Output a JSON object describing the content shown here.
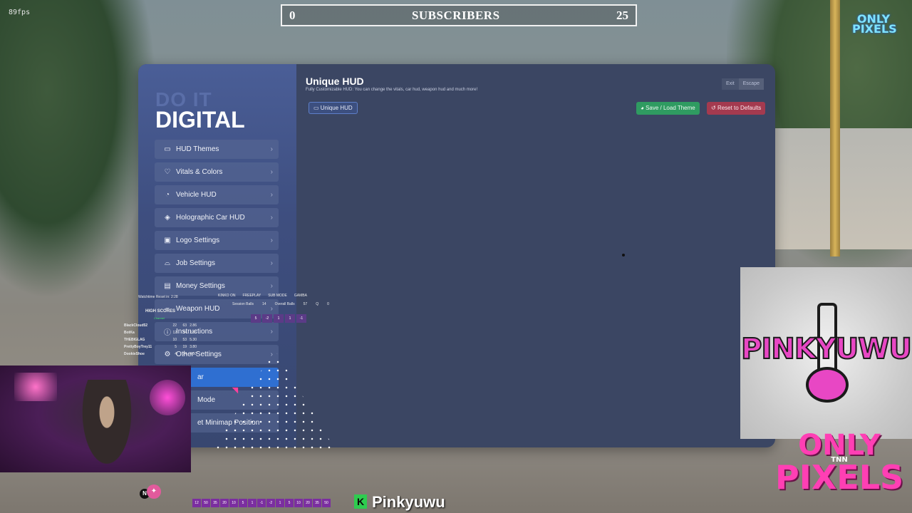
{
  "overlay_top": {
    "fps": "89fps",
    "subscribers_left": "0",
    "subscribers_label": "SUBSCRIBERS",
    "subscribers_right": "25",
    "corner_logo": "ONLY PIXELS"
  },
  "panel": {
    "brand_top": "DO IT",
    "brand_bottom": "DIGITAL",
    "title": "Unique HUD",
    "subtitle": "Fully Customizable HUD: You can change the vitals, car hud, weapon hud and much more!",
    "exit_label": "Exit",
    "escape_label": "Escape",
    "tab_label": "Unique HUD",
    "save_label": "Save / Load Theme",
    "reset_label": "Reset to Defaults",
    "menu": [
      {
        "label": "HUD Themes",
        "icon": "monitor-icon"
      },
      {
        "label": "Vitals & Colors",
        "icon": "heart-icon"
      },
      {
        "label": "Vehicle HUD",
        "icon": "speedometer-icon"
      },
      {
        "label": "Holographic Car HUD",
        "icon": "cube-icon"
      },
      {
        "label": "Logo Settings",
        "icon": "image-icon"
      },
      {
        "label": "Job Settings",
        "icon": "helmet-icon"
      },
      {
        "label": "Money Settings",
        "icon": "money-icon"
      },
      {
        "label": "Weapon HUD",
        "icon": "gun-icon"
      },
      {
        "label": "Instructions",
        "icon": "info-icon"
      },
      {
        "label": "Other Settings",
        "icon": "gear-icon"
      },
      {
        "label": "ar",
        "icon": ""
      },
      {
        "label": "Mode",
        "icon": ""
      },
      {
        "label": "et Minimap Position",
        "icon": ""
      }
    ]
  },
  "stats_overlay": {
    "watch": "Watchtime Reset in: 2:28",
    "kinko": "KINKO ON",
    "freeplay": "FREEPLAY",
    "submode": "SUB MODE",
    "gamba": "GAMBA",
    "session_balls_label": "Session Balls",
    "session_balls": "14",
    "overall_balls_label": "Overall Balls",
    "overall_balls": "57",
    "q": "Q",
    "zero": "0",
    "high_scores": "HIGH SCORES",
    "channel": "Channel",
    "nums": [
      "5",
      "-2",
      "1",
      "1",
      "-1"
    ],
    "rows": [
      {
        "name": "BlackCloud52",
        "a": "22",
        "b": "63",
        "c": "2.86"
      },
      {
        "name": "BotKa",
        "a": "12",
        "b": "34",
        "c": "2.83"
      },
      {
        "name": "THEBIGLAG",
        "a": "10",
        "b": "53",
        "c": "5.30"
      },
      {
        "name": "PrettyBoyTrey11",
        "a": "5",
        "b": "19",
        "c": "3.80"
      },
      {
        "name": "DookieShoe",
        "a": "4",
        "b": "14",
        "c": "3.50"
      }
    ]
  },
  "bottom": {
    "strip": [
      "12",
      "50",
      "35",
      "20",
      "10",
      "5",
      "1",
      "-1",
      "-2",
      "1",
      "5",
      "10",
      "20",
      "35",
      "50"
    ],
    "twitch_icon": "K",
    "channel_name": "Pinkyuwu",
    "minimap_letter": "N"
  },
  "logos": {
    "pinky": "PINKYUWU",
    "only": "ONLY",
    "tnn": "TNN",
    "pixels": "PIXELS"
  }
}
